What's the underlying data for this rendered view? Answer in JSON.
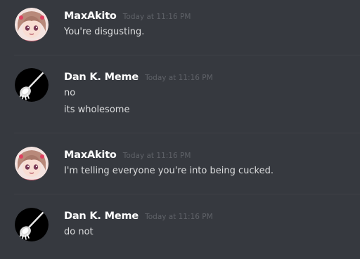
{
  "messages": [
    {
      "author": "MaxAkito",
      "timestamp": "Today at 11:16 PM",
      "avatar_icon": "anime-girl-avatar",
      "lines": [
        "You're disgusting."
      ]
    },
    {
      "author": "Dan K. Meme",
      "timestamp": "Today at 11:16 PM",
      "avatar_icon": "mop-avatar",
      "lines": [
        "no",
        "its wholesome"
      ]
    },
    {
      "author": "MaxAkito",
      "timestamp": "Today at 11:16 PM",
      "avatar_icon": "anime-girl-avatar",
      "lines": [
        "I'm telling everyone you're into being cucked."
      ]
    },
    {
      "author": "Dan K. Meme",
      "timestamp": "Today at 11:16 PM",
      "avatar_icon": "mop-avatar",
      "lines": [
        "do not"
      ]
    }
  ],
  "colors": {
    "background": "#36393f",
    "username": "#ffffff",
    "timestamp": "#5f6268",
    "message_text": "#dcddde",
    "divider": "#3f4147"
  }
}
